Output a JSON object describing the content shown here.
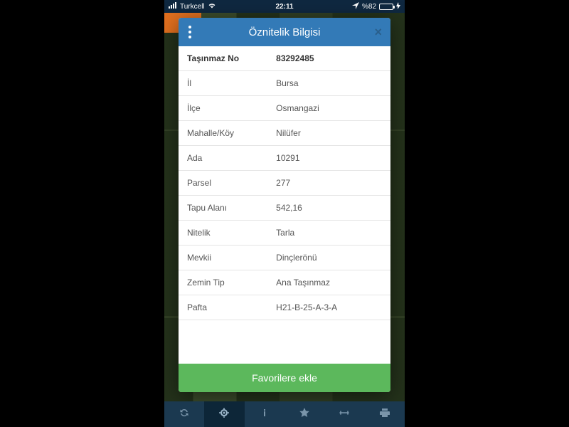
{
  "statusbar": {
    "carrier": "Turkcell",
    "time": "22:11",
    "battery_pct": "%82"
  },
  "modal": {
    "title": "Öznitelik Bilgisi",
    "rows": [
      {
        "key": "Taşınmaz No",
        "value": "83292485",
        "head": true
      },
      {
        "key": "İl",
        "value": "Bursa"
      },
      {
        "key": "İlçe",
        "value": "Osmangazi"
      },
      {
        "key": "Mahalle/Köy",
        "value": "Nilüfer"
      },
      {
        "key": "Ada",
        "value": "10291"
      },
      {
        "key": "Parsel",
        "value": "277"
      },
      {
        "key": "Tapu Alanı",
        "value": "542,16"
      },
      {
        "key": "Nitelik",
        "value": "Tarla"
      },
      {
        "key": "Mevkii",
        "value": "Dinçlerönü"
      },
      {
        "key": "Zemin Tip",
        "value": "Ana Taşınmaz"
      },
      {
        "key": "Pafta",
        "value": "H21-B-25-A-3-A"
      }
    ],
    "footer_button": "Favorilere ekle"
  },
  "toolbar": {
    "items": [
      {
        "name": "refresh-icon",
        "active": false
      },
      {
        "name": "locate-icon",
        "active": true
      },
      {
        "name": "info-icon",
        "active": false
      },
      {
        "name": "star-icon",
        "active": false
      },
      {
        "name": "measure-icon",
        "active": false
      },
      {
        "name": "print-icon",
        "active": false
      }
    ]
  }
}
